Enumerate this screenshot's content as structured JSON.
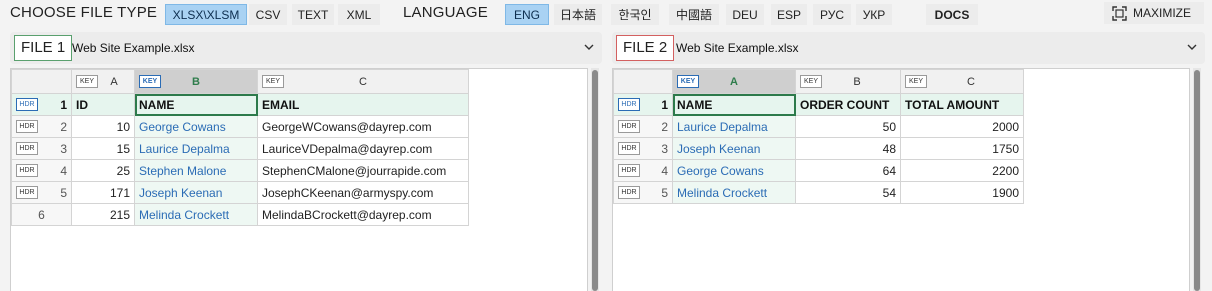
{
  "toolbar": {
    "file_type_label": "CHOOSE FILE TYPE",
    "file_types": [
      {
        "label": "XLSX\\XLSM",
        "active": true
      },
      {
        "label": "CSV",
        "active": false
      },
      {
        "label": "TEXT",
        "active": false
      },
      {
        "label": "XML",
        "active": false
      }
    ],
    "language_label": "LANGUAGE",
    "languages": [
      {
        "label": "ENG",
        "active": true
      },
      {
        "label": "日本語",
        "active": false
      },
      {
        "label": "한국인",
        "active": false
      },
      {
        "label": "中國語",
        "active": false
      },
      {
        "label": "DEU",
        "active": false
      },
      {
        "label": "ESP",
        "active": false
      },
      {
        "label": "РУС",
        "active": false
      },
      {
        "label": "УКР",
        "active": false
      }
    ],
    "docs_label": "DOCS",
    "maximize_label": "MAXIMIZE"
  },
  "file1": {
    "badge": "FILE 1",
    "filename": "Web Site Example.xlsx",
    "key_tag": "KEY",
    "hdr_tag": "HDR",
    "columns": [
      "A",
      "B",
      "C"
    ],
    "row_numbers": [
      "1",
      "2",
      "3",
      "4",
      "5",
      "6"
    ],
    "header": [
      "ID",
      "NAME",
      "EMAIL"
    ],
    "rows": [
      [
        "10",
        "George Cowans",
        "GeorgeWCowans@dayrep.com"
      ],
      [
        "15",
        "Laurice Depalma",
        "LauriceVDepalma@dayrep.com"
      ],
      [
        "25",
        "Stephen Malone",
        "StephenCMalone@jourrapide.com"
      ],
      [
        "171",
        "Joseph Keenan",
        "JosephCKeenan@armyspy.com"
      ],
      [
        "215",
        "Melinda Crockett",
        "MelindaBCrockett@dayrep.com"
      ]
    ]
  },
  "file2": {
    "badge": "FILE 2",
    "filename": "Web Site Example.xlsx",
    "key_tag": "KEY",
    "hdr_tag": "HDR",
    "columns": [
      "A",
      "B",
      "C"
    ],
    "row_numbers": [
      "1",
      "2",
      "3",
      "4",
      "5"
    ],
    "header": [
      "NAME",
      "ORDER COUNT",
      "TOTAL AMOUNT"
    ],
    "rows": [
      [
        "Laurice Depalma",
        "50",
        "2000"
      ],
      [
        "Joseph Keenan",
        "48",
        "1750"
      ],
      [
        "George Cowans",
        "64",
        "2200"
      ],
      [
        "Melinda Crockett",
        "54",
        "1900"
      ]
    ]
  },
  "colors": {
    "active_button": "#a9d2f3",
    "key_blue": "#2b6cb5",
    "header_green": "#2f7d4c",
    "file1_border": "#5aa06e",
    "file2_border": "#d36060"
  }
}
